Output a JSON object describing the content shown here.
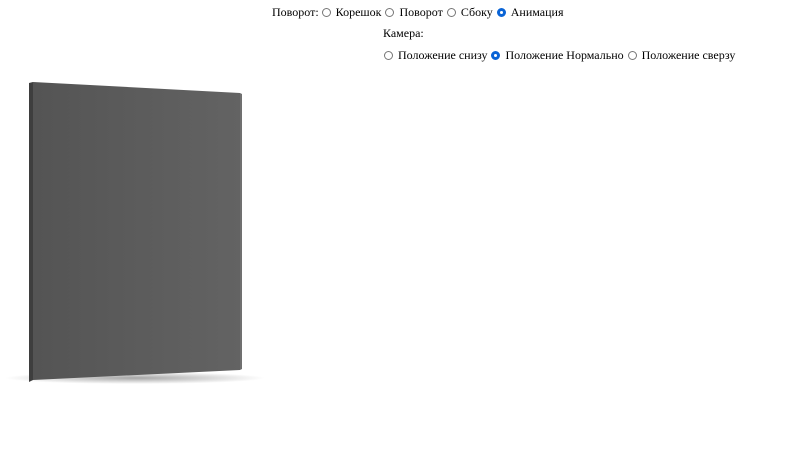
{
  "rotation": {
    "label": "Поворот:",
    "options": [
      {
        "label": "Корешок",
        "checked": false
      },
      {
        "label": "Поворот",
        "checked": false
      },
      {
        "label": "Сбоку",
        "checked": false
      },
      {
        "label": "Анимация",
        "checked": true
      }
    ]
  },
  "camera": {
    "label": "Камера:",
    "options": [
      {
        "label": "Положение снизу",
        "checked": false
      },
      {
        "label": "Положение Нормально",
        "checked": true
      },
      {
        "label": "Положение сверзу",
        "checked": false
      }
    ]
  },
  "book": {
    "cover_color": "#5a5a5a"
  }
}
